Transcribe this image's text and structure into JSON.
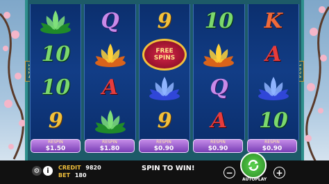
{
  "reel_size_badge": "1024",
  "reels": [
    [
      "lotus-green",
      "10",
      "10",
      "9"
    ],
    [
      "Q",
      "lotus-gold",
      "A",
      "lotus-green"
    ],
    [
      "9",
      "free-spins",
      "lotus-blue",
      "9"
    ],
    [
      "10",
      "lotus-gold",
      "Q",
      "A"
    ],
    [
      "K",
      "A",
      "lotus-blue",
      "10"
    ]
  ],
  "free_spins_text": "FREE SPINS",
  "respin_buttons": [
    {
      "label": "RESPIN",
      "price": "$1.50"
    },
    {
      "label": "RESPIN",
      "price": "$1.80"
    },
    {
      "label": "RESPIN",
      "price": "$0.90"
    },
    {
      "label": "RESPIN",
      "price": "$0.90"
    },
    {
      "label": "RESPIN",
      "price": "$0.90"
    }
  ],
  "bottom_bar": {
    "credit_label": "CREDIT",
    "credit_value": "9820",
    "bet_label": "BET",
    "bet_value": "180",
    "message": "SPIN TO WIN!",
    "minus_label": "−",
    "plus_label": "+",
    "autoplay_label": "AUTOPLAY"
  },
  "colors": {
    "frame": "#1d5a68",
    "reel_bg": "#123d86",
    "respin_bg": "#9b5ad0",
    "spin_green": "#3fb43a"
  }
}
